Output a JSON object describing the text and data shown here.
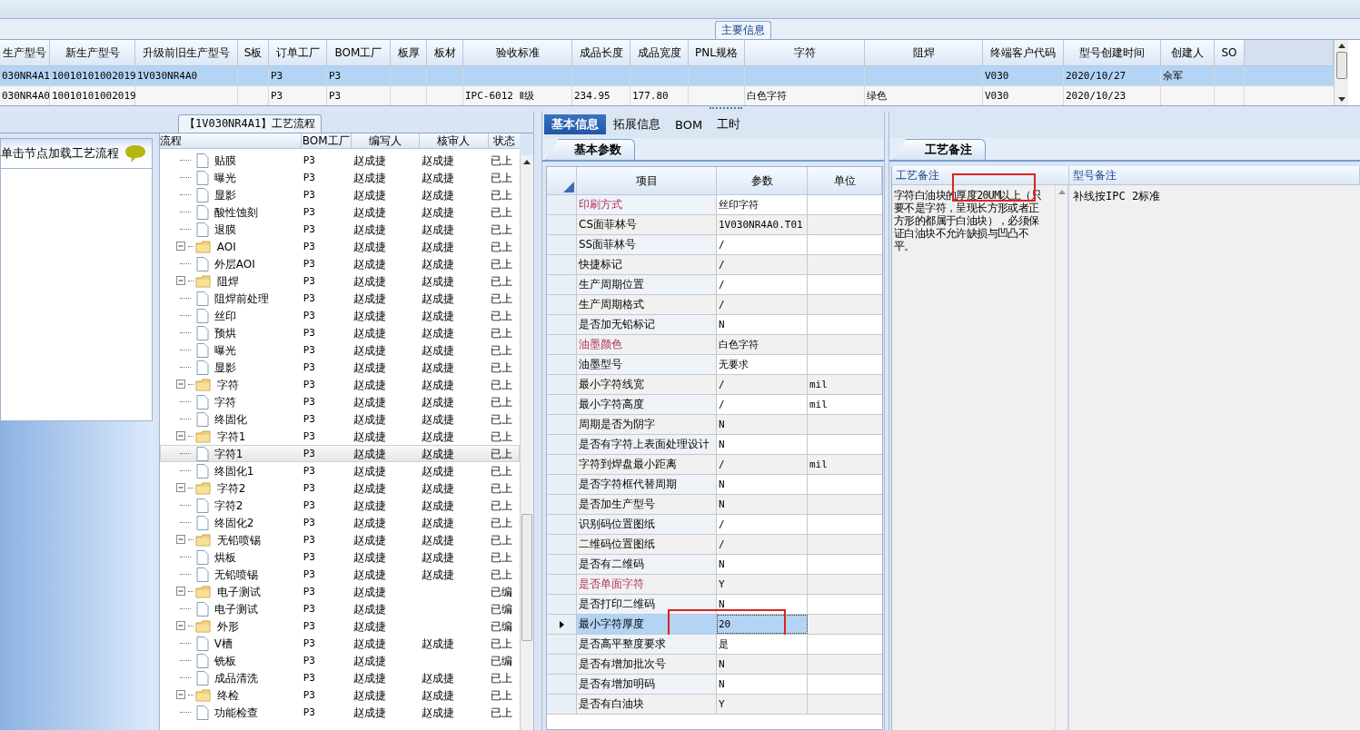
{
  "main_info": {
    "title": "主要信息",
    "columns": [
      "生产型号",
      "新生产型号",
      "升级前旧生产型号",
      "S板",
      "订单工厂",
      "BOM工厂",
      "板厚",
      "板材",
      "验收标准",
      "成品长度",
      "成品宽度",
      "PNL规格",
      "字符",
      "阻焊",
      "终端客户代码",
      "型号创建时间",
      "创建人",
      "SO"
    ],
    "rows": [
      {
        "selected": true,
        "cells": [
          "030NR4A1",
          "10010101002019",
          "1V030NR4A0",
          null,
          "P3",
          "P3",
          null,
          null,
          null,
          null,
          null,
          null,
          null,
          null,
          "V030",
          "2020/10/27",
          "佘军",
          null
        ]
      },
      {
        "selected": false,
        "cells": [
          "030NR4A0",
          "10010101002019",
          null,
          null,
          "P3",
          "P3",
          null,
          null,
          "IPC-6012 Ⅱ级",
          "234.95",
          "177.80",
          null,
          "白色字符",
          "绿色",
          "V030",
          "2020/10/23",
          null,
          null
        ]
      }
    ]
  },
  "left_panel": {
    "hint": "单击节点加载工艺流程"
  },
  "process_flow": {
    "title": "【1V030NR4A1】工艺流程",
    "columns": [
      "流程",
      "BOM工厂",
      "编写人",
      "核审人",
      "状态"
    ],
    "nodes": [
      {
        "kind": "continued",
        "children": [
          {
            "name": "贴膜",
            "bom": "P3",
            "writer": "赵成捷",
            "reviewer": "赵成捷",
            "status": "已上",
            "selected": false
          },
          {
            "name": "曝光",
            "bom": "P3",
            "writer": "赵成捷",
            "reviewer": "赵成捷",
            "status": "已上",
            "selected": false
          },
          {
            "name": "显影",
            "bom": "P3",
            "writer": "赵成捷",
            "reviewer": "赵成捷",
            "status": "已上",
            "selected": false
          },
          {
            "name": "酸性蚀刻",
            "bom": "P3",
            "writer": "赵成捷",
            "reviewer": "赵成捷",
            "status": "已上",
            "selected": false
          },
          {
            "name": "退膜",
            "bom": "P3",
            "writer": "赵成捷",
            "reviewer": "赵成捷",
            "status": "已上",
            "selected": false
          }
        ]
      },
      {
        "kind": "group",
        "name": "AOI",
        "bom": "P3",
        "writer": "赵成捷",
        "reviewer": "赵成捷",
        "status": "已上",
        "selected": false,
        "expanded": true,
        "children": [
          {
            "name": "外层AOI",
            "bom": "P3",
            "writer": "赵成捷",
            "reviewer": "赵成捷",
            "status": "已上",
            "selected": false
          }
        ]
      },
      {
        "kind": "group",
        "name": "阻焊",
        "bom": "P3",
        "writer": "赵成捷",
        "reviewer": "赵成捷",
        "status": "已上",
        "selected": false,
        "expanded": true,
        "children": [
          {
            "name": "阻焊前处理",
            "bom": "P3",
            "writer": "赵成捷",
            "reviewer": "赵成捷",
            "status": "已上",
            "selected": false
          },
          {
            "name": "丝印",
            "bom": "P3",
            "writer": "赵成捷",
            "reviewer": "赵成捷",
            "status": "已上",
            "selected": false
          },
          {
            "name": "预烘",
            "bom": "P3",
            "writer": "赵成捷",
            "reviewer": "赵成捷",
            "status": "已上",
            "selected": false
          },
          {
            "name": "曝光",
            "bom": "P3",
            "writer": "赵成捷",
            "reviewer": "赵成捷",
            "status": "已上",
            "selected": false
          },
          {
            "name": "显影",
            "bom": "P3",
            "writer": "赵成捷",
            "reviewer": "赵成捷",
            "status": "已上",
            "selected": false
          }
        ]
      },
      {
        "kind": "group",
        "name": "字符",
        "bom": "P3",
        "writer": "赵成捷",
        "reviewer": "赵成捷",
        "status": "已上",
        "selected": false,
        "expanded": true,
        "children": [
          {
            "name": "字符",
            "bom": "P3",
            "writer": "赵成捷",
            "reviewer": "赵成捷",
            "status": "已上",
            "selected": false
          },
          {
            "name": "终固化",
            "bom": "P3",
            "writer": "赵成捷",
            "reviewer": "赵成捷",
            "status": "已上",
            "selected": false
          }
        ]
      },
      {
        "kind": "group",
        "name": "字符1",
        "bom": "P3",
        "writer": "赵成捷",
        "reviewer": "赵成捷",
        "status": "已上",
        "selected": false,
        "expanded": true,
        "children": [
          {
            "name": "字符1",
            "bom": "P3",
            "writer": "赵成捷",
            "reviewer": "赵成捷",
            "status": "已上",
            "selected": true
          },
          {
            "name": "终固化1",
            "bom": "P3",
            "writer": "赵成捷",
            "reviewer": "赵成捷",
            "status": "已上",
            "selected": false
          }
        ]
      },
      {
        "kind": "group",
        "name": "字符2",
        "bom": "P3",
        "writer": "赵成捷",
        "reviewer": "赵成捷",
        "status": "已上",
        "selected": false,
        "expanded": true,
        "children": [
          {
            "name": "字符2",
            "bom": "P3",
            "writer": "赵成捷",
            "reviewer": "赵成捷",
            "status": "已上",
            "selected": false
          },
          {
            "name": "终固化2",
            "bom": "P3",
            "writer": "赵成捷",
            "reviewer": "赵成捷",
            "status": "已上",
            "selected": false
          }
        ]
      },
      {
        "kind": "group",
        "name": "无铅喷锡",
        "bom": "P3",
        "writer": "赵成捷",
        "reviewer": "赵成捷",
        "status": "已上",
        "selected": false,
        "expanded": true,
        "children": [
          {
            "name": "烘板",
            "bom": "P3",
            "writer": "赵成捷",
            "reviewer": "赵成捷",
            "status": "已上",
            "selected": false
          },
          {
            "name": "无铅喷锡",
            "bom": "P3",
            "writer": "赵成捷",
            "reviewer": "赵成捷",
            "status": "已上",
            "selected": false
          }
        ]
      },
      {
        "kind": "group",
        "name": "电子测试",
        "bom": "P3",
        "writer": "赵成捷",
        "status": "已编",
        "selected": false,
        "expanded": true,
        "children": [
          {
            "name": "电子测试",
            "bom": "P3",
            "writer": "赵成捷",
            "status": "已编",
            "selected": false
          }
        ]
      },
      {
        "kind": "group",
        "name": "外形",
        "bom": "P3",
        "writer": "赵成捷",
        "status": "已编",
        "selected": false,
        "expanded": true,
        "children": [
          {
            "name": "V槽",
            "bom": "P3",
            "writer": "赵成捷",
            "reviewer": "赵成捷",
            "status": "已上",
            "selected": false
          },
          {
            "name": "铣板",
            "bom": "P3",
            "writer": "赵成捷",
            "status": "已编",
            "selected": false
          },
          {
            "name": "成品清洗",
            "bom": "P3",
            "writer": "赵成捷",
            "reviewer": "赵成捷",
            "status": "已上",
            "selected": false
          }
        ]
      },
      {
        "kind": "group",
        "name": "终检",
        "bom": "P3",
        "writer": "赵成捷",
        "reviewer": "赵成捷",
        "status": "已上",
        "selected": false,
        "expanded": true,
        "children": [
          {
            "name": "功能检查",
            "bom": "P3",
            "writer": "赵成捷",
            "reviewer": "赵成捷",
            "status": "已上",
            "selected": false
          }
        ]
      }
    ]
  },
  "detail_tabs": [
    {
      "label": "基本信息",
      "selected": true
    },
    {
      "label": "拓展信息",
      "selected": false
    },
    {
      "label": "BOM",
      "selected": false
    },
    {
      "label": "工时",
      "selected": false
    }
  ],
  "basic_params": {
    "tab": "基本参数",
    "columns": [
      "项目",
      "参数",
      "单位"
    ],
    "rows": [
      {
        "item": "印刷方式",
        "value": "丝印字符",
        "kind": "required",
        "selected": false
      },
      {
        "item": "CS面菲林号",
        "value": "1V030NR4A0.T01",
        "kind": "normal",
        "selected": false
      },
      {
        "item": "SS面菲林号",
        "value": "/",
        "kind": "normal",
        "selected": false
      },
      {
        "item": "快捷标记",
        "value": "/",
        "kind": "normal",
        "selected": false
      },
      {
        "item": "生产周期位置",
        "value": "/",
        "kind": "normal",
        "selected": false
      },
      {
        "item": "生产周期格式",
        "value": "/",
        "kind": "normal",
        "selected": false
      },
      {
        "item": "是否加无铅标记",
        "value": "N",
        "kind": "normal",
        "selected": false
      },
      {
        "item": "油墨颜色",
        "value": "白色字符",
        "kind": "required",
        "selected": false
      },
      {
        "item": "油墨型号",
        "value": "无要求",
        "kind": "normal",
        "selected": false
      },
      {
        "item": "最小字符线宽",
        "value": "/",
        "unit": "mil",
        "kind": "normal",
        "selected": false
      },
      {
        "item": "最小字符高度",
        "value": "/",
        "unit": "mil",
        "kind": "normal",
        "selected": false
      },
      {
        "item": "周期是否为阴字",
        "value": "N",
        "kind": "normal",
        "selected": false
      },
      {
        "item": "是否有字符上表面处理设计",
        "value": "N",
        "kind": "normal",
        "selected": false
      },
      {
        "item": "字符到焊盘最小距离",
        "value": "/",
        "unit": "mil",
        "kind": "normal",
        "selected": false
      },
      {
        "item": "是否字符框代替周期",
        "value": "N",
        "kind": "normal",
        "selected": false
      },
      {
        "item": "是否加生产型号",
        "value": "N",
        "kind": "normal",
        "selected": false
      },
      {
        "item": "识别码位置图纸",
        "value": "/",
        "kind": "normal",
        "selected": false
      },
      {
        "item": "二维码位置图纸",
        "value": "/",
        "kind": "normal",
        "selected": false
      },
      {
        "item": "是否有二维码",
        "value": "N",
        "kind": "normal",
        "selected": false
      },
      {
        "item": "是否单面字符",
        "value": "Y",
        "kind": "required",
        "selected": false
      },
      {
        "item": "是否打印二维码",
        "value": "N",
        "kind": "normal",
        "selected": false
      },
      {
        "item": "最小字符厚度",
        "value": "20",
        "kind": "normal",
        "selected": true,
        "annotated": true
      },
      {
        "item": "是否高平整度要求",
        "value": "是",
        "kind": "normal",
        "selected": false
      },
      {
        "item": "是否有增加批次号",
        "value": "N",
        "kind": "normal",
        "selected": false
      },
      {
        "item": "是否有增加明码",
        "value": "N",
        "kind": "normal",
        "selected": false
      },
      {
        "item": "是否有白油块",
        "value": "Y",
        "kind": "normal",
        "selected": false
      }
    ]
  },
  "process_notes": {
    "tab": "工艺备注",
    "columns": [
      "工艺备注",
      "型号备注"
    ],
    "process_note": "字符白油块的厚度20UM以上（只要不是字符，呈现长方形或者正方形的都属于白油块），必须保证白油块不允许缺损与凹凸不平。",
    "process_note_annotated": true,
    "model_note": "补线按IPC 2标准"
  }
}
